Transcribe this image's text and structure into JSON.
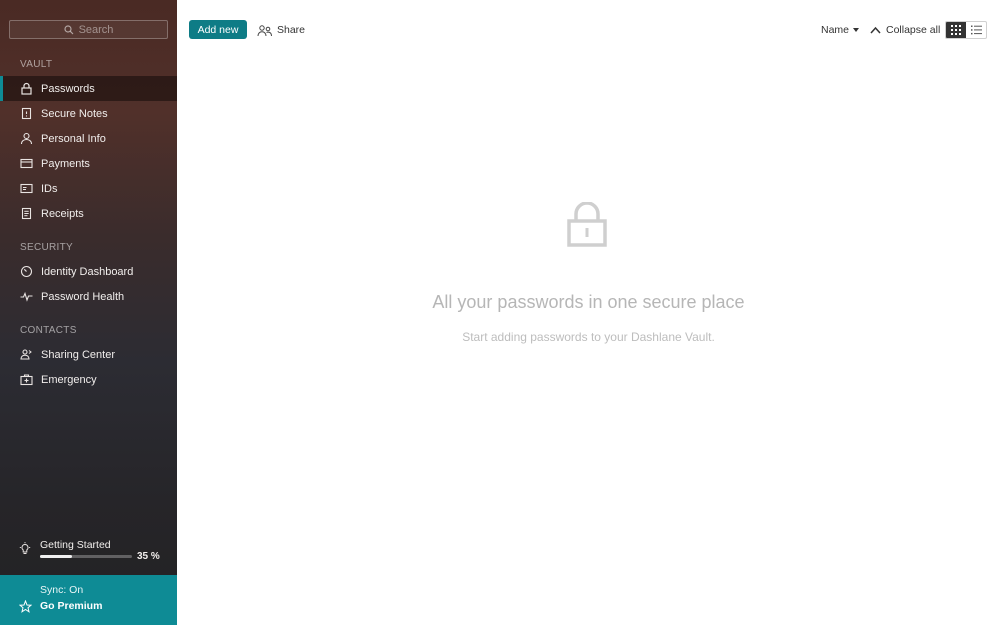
{
  "sidebar": {
    "search": {
      "placeholder": "Search"
    },
    "sections": {
      "vault": "VAULT",
      "security": "SECURITY",
      "contacts": "CONTACTS"
    },
    "items": [
      {
        "label": "Passwords",
        "icon": "lock-icon",
        "active": true
      },
      {
        "label": "Secure Notes",
        "icon": "note-icon"
      },
      {
        "label": "Personal Info",
        "icon": "person-icon"
      },
      {
        "label": "Payments",
        "icon": "card-icon"
      },
      {
        "label": "IDs",
        "icon": "id-icon"
      },
      {
        "label": "Receipts",
        "icon": "receipt-icon"
      },
      {
        "label": "Identity Dashboard",
        "icon": "gauge-icon"
      },
      {
        "label": "Password Health",
        "icon": "pulse-icon"
      },
      {
        "label": "Sharing Center",
        "icon": "sharing-icon"
      },
      {
        "label": "Emergency",
        "icon": "emergency-icon"
      }
    ],
    "getting_started": {
      "label": "Getting Started",
      "percent_text": "35 %",
      "progress": 0.35
    },
    "sync_text": "Sync: On",
    "premium_label": "Go Premium"
  },
  "toolbar": {
    "add_new_label": "Add new",
    "share_label": "Share",
    "sort_label": "Name",
    "collapse_label": "Collapse all"
  },
  "empty_state": {
    "title": "All your passwords in one secure place",
    "subtitle": "Start adding passwords to your Dashlane Vault."
  },
  "colors": {
    "accent": "#0e8b95",
    "button": "#0e7c86",
    "sidebar_top": "#4a2a24",
    "sidebar_bottom": "#232223"
  }
}
